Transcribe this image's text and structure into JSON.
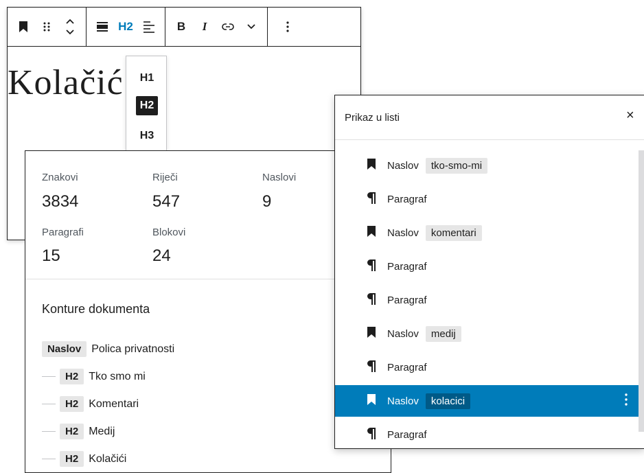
{
  "toolbar": {
    "bookmark_icon": "bookmark-icon",
    "drag_icon": "drag-handle-icon",
    "move_icon": "chevron-updown-icon",
    "align_icon": "align-icon",
    "heading_level": "H2",
    "text_align_icon": "text-align-icon",
    "bold": "B",
    "italic": "I",
    "link_icon": "link-icon",
    "more_rich_icon": "chevron-down-icon",
    "options_icon": "more-vertical-icon"
  },
  "editor": {
    "heading_text": "Kolačić"
  },
  "heading_levels": [
    "H1",
    "H2",
    "H3"
  ],
  "info": {
    "stats_row1": [
      {
        "label": "Znakovi",
        "value": "3834"
      },
      {
        "label": "Riječi",
        "value": "547"
      },
      {
        "label": "Naslovi",
        "value": "9"
      }
    ],
    "stats_row2": [
      {
        "label": "Paragrafi",
        "value": "15"
      },
      {
        "label": "Blokovi",
        "value": "24"
      }
    ],
    "outline_title": "Konture dokumenta",
    "outline": [
      {
        "tag": "Naslov",
        "text": "Polica privatnosti"
      },
      {
        "tag": "H2",
        "text": "Tko smo mi"
      },
      {
        "tag": "H2",
        "text": "Komentari"
      },
      {
        "tag": "H2",
        "text": "Medij"
      },
      {
        "tag": "H2",
        "text": "Kolačići"
      }
    ]
  },
  "list_view": {
    "title": "Prikaz u listi",
    "close": "×",
    "items": [
      {
        "icon": "bookmark-icon",
        "label": "Naslov",
        "anchor": "tko-smo-mi"
      },
      {
        "icon": "paragraph-icon",
        "label": "Paragraf",
        "anchor": ""
      },
      {
        "icon": "bookmark-icon",
        "label": "Naslov",
        "anchor": "komentari"
      },
      {
        "icon": "paragraph-icon",
        "label": "Paragraf",
        "anchor": ""
      },
      {
        "icon": "paragraph-icon",
        "label": "Paragraf",
        "anchor": ""
      },
      {
        "icon": "bookmark-icon",
        "label": "Naslov",
        "anchor": "medij"
      },
      {
        "icon": "paragraph-icon",
        "label": "Paragraf",
        "anchor": ""
      },
      {
        "icon": "bookmark-icon",
        "label": "Naslov",
        "anchor": "kolacici"
      },
      {
        "icon": "paragraph-icon",
        "label": "Paragraf",
        "anchor": ""
      }
    ],
    "selected_index": 7,
    "accent": "#007cba"
  }
}
